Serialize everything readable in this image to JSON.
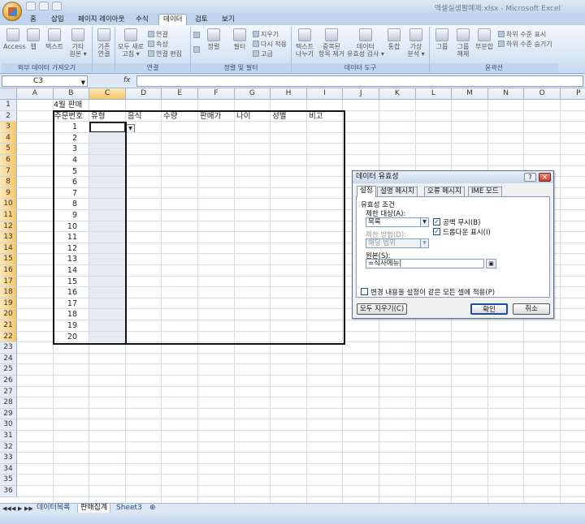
{
  "window": {
    "title": "엑셀실생활예제.xlsx - Microsoft Excel"
  },
  "ribbon_tabs": [
    "홈",
    "삽입",
    "페이지 레이아웃",
    "수식",
    "데이터",
    "검토",
    "보기"
  ],
  "ribbon": {
    "groups": {
      "external": "외부 데이터 가져오기",
      "connections": "연결",
      "sort_filter": "정렬 및 필터",
      "data_tools": "데이터 도구",
      "outline": "윤곽선"
    },
    "buttons": {
      "access": "Access",
      "web": "웹",
      "text": "텍스트",
      "other1": "기타",
      "other2": "원본 ▾",
      "existing1": "기존",
      "existing2": "연결",
      "refresh1": "모두 새로",
      "refresh2": "고침 ▾",
      "connections": "연결",
      "properties": "속성",
      "edit_links": "연결 편집",
      "sort": "정렬",
      "filter": "필터",
      "clear": "지우기",
      "reapply": "다시 적용",
      "advanced": "고급",
      "text_to_cols1": "텍스트",
      "text_to_cols2": "나누기",
      "remove_dup1": "중복된",
      "remove_dup2": "항목 제거",
      "validation1": "데이터",
      "validation2": "유효성 검사 ▾",
      "consolidate": "통합",
      "whatif1": "가상",
      "whatif2": "분석 ▾",
      "group": "그룹",
      "ungroup1": "그룹",
      "ungroup2": "해제",
      "subtotal": "부분합",
      "show_detail": "하위 수준 표시",
      "hide_detail": "하위 수준 숨기기"
    }
  },
  "formula_bar": {
    "name_box": "C3",
    "fx": "fx",
    "formula": ""
  },
  "columns": [
    "A",
    "B",
    "C",
    "D",
    "E",
    "F",
    "G",
    "H",
    "I",
    "J",
    "K",
    "L",
    "M",
    "N",
    "O",
    "P"
  ],
  "rows": [
    "1",
    "2",
    "3",
    "4",
    "5",
    "6",
    "7",
    "8",
    "9",
    "10",
    "11",
    "12",
    "13",
    "14",
    "15",
    "16",
    "17",
    "18",
    "19",
    "20",
    "21",
    "22",
    "23",
    "24",
    "25",
    "26",
    "27",
    "28",
    "29",
    "30",
    "31",
    "32",
    "33",
    "34",
    "35",
    "36"
  ],
  "sheet": {
    "title": "4월 판매",
    "headers": [
      "주문번호",
      "유형",
      "음식",
      "수량",
      "판매가",
      "나이",
      "성별",
      "비고"
    ],
    "order_numbers": [
      "1",
      "2",
      "3",
      "4",
      "5",
      "6",
      "7",
      "8",
      "9",
      "10",
      "11",
      "12",
      "13",
      "14",
      "15",
      "16",
      "17",
      "18",
      "19",
      "20"
    ]
  },
  "sheet_tabs": {
    "nav": [
      "◀◀",
      "◀",
      "▶",
      "▶▶"
    ],
    "tabs": [
      "데이터목록",
      "판매집계",
      "Sheet3"
    ],
    "active": "판매집계"
  },
  "dialog": {
    "title": "데이터 유효성",
    "help": "?",
    "close": "✕",
    "tabs": [
      "설정",
      "설명 메시지",
      "오류 메시지",
      "IME 모드"
    ],
    "criteria_label": "유효성 조건",
    "allow_label": "제한 대상(A):",
    "allow_value": "목록",
    "ignore_blank": "공백 무시(B)",
    "dropdown": "드롭다운 표시(I)",
    "data_label": "제한 방법(D):",
    "data_value": "해당 범위",
    "source_label": "원본(S):",
    "source_value": "=식사메뉴|",
    "apply_all": "변경 내용을 설정이 같은 모든 셀에 적용(P)",
    "clear_all": "모두 지우기(C)",
    "ok": "확인",
    "cancel": "취소"
  }
}
